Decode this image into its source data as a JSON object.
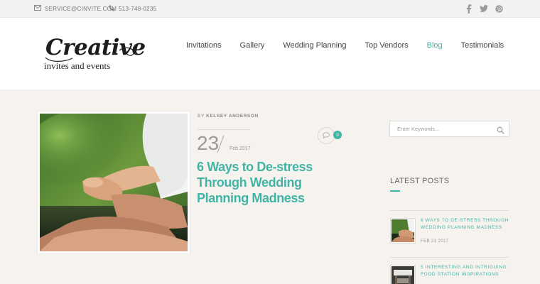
{
  "topbar": {
    "email": "SERVICE@CINVITE.COM",
    "phone": "513-748-0235",
    "email_icon": "envelope-icon",
    "phone_icon": "phone-icon",
    "social_icons": [
      "facebook-icon",
      "twitter-icon",
      "pinterest-icon"
    ]
  },
  "logo": {
    "script": "Creative",
    "subtitle": "invites and events"
  },
  "nav": {
    "items": [
      "Invitations",
      "Gallery",
      "Wedding Planning",
      "Top Vendors",
      "Blog",
      "Testimonials"
    ],
    "active": "Blog"
  },
  "post": {
    "author_prefix": "BY",
    "author": "KELSEY ANDERSON",
    "day": "23",
    "month_year": "Feb 2017",
    "comment_count": "0",
    "title": "6 Ways to De-stress Through Wedding Planning Madness"
  },
  "sidebar": {
    "search_placeholder": "Enter Keywords...",
    "latest_heading": "LATEST POSTS",
    "latest_posts": [
      {
        "title": "6 WAYS TO DE-STRESS THROUGH WEDDING PLANNING MADNESS",
        "date": "FEB 23 2017"
      },
      {
        "title": "5 INTERESTING AND INTRIGUING FOOD STATION INSPIRATIONS",
        "date": ""
      }
    ]
  },
  "colors": {
    "accent": "#42b4a5",
    "page_bg": "#f6f3ef",
    "topbar_bg": "#f2f2f2"
  }
}
